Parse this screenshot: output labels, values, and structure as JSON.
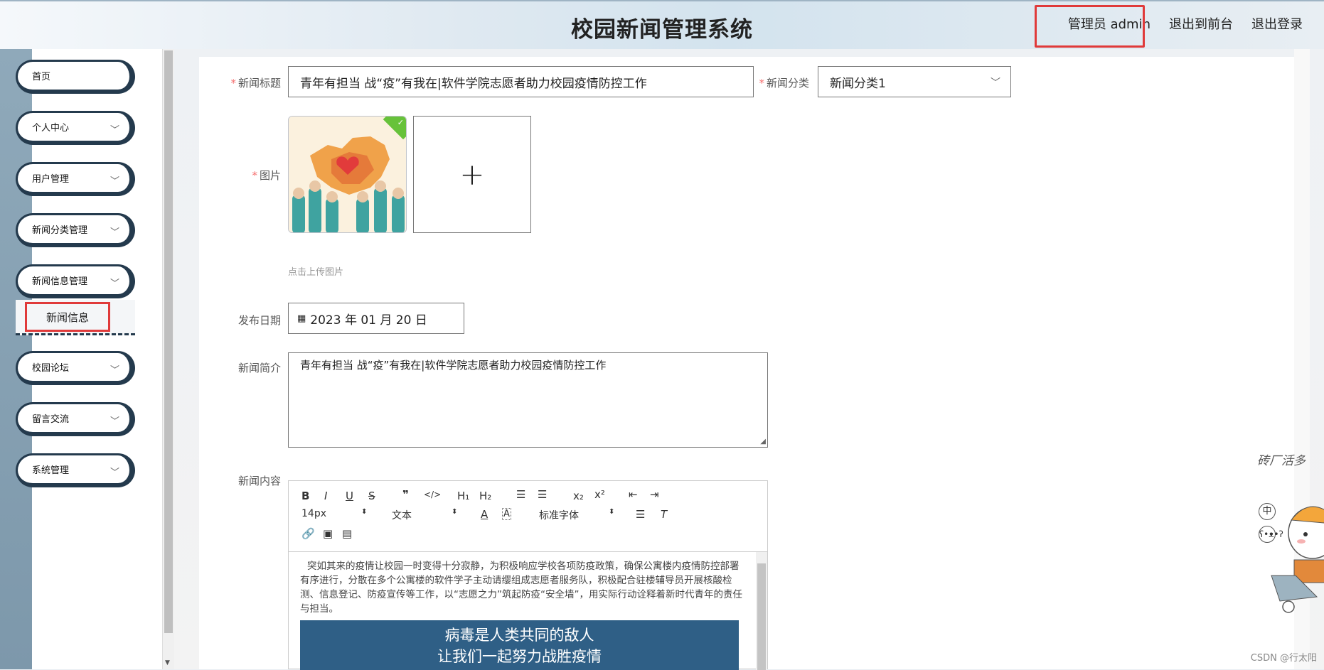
{
  "header": {
    "title": "校园新闻管理系统",
    "admin_label": "管理员 admin",
    "frontend_link": "退出到前台",
    "logout_link": "退出登录"
  },
  "sidebar": {
    "items": [
      {
        "label": "首页"
      },
      {
        "label": "个人中心"
      },
      {
        "label": "用户管理"
      },
      {
        "label": "新闻分类管理"
      },
      {
        "label": "新闻信息管理"
      },
      {
        "label": "校园论坛"
      },
      {
        "label": "留言交流"
      },
      {
        "label": "系统管理"
      }
    ],
    "active_sub": "新闻信息"
  },
  "form": {
    "title_label": "新闻标题",
    "title_value": "青年有担当 战“疫”有我在|软件学院志愿者助力校园疫情防控工作",
    "category_label": "新闻分类",
    "category_value": "新闻分类1",
    "image_label": "图片",
    "upload_plus": "+",
    "upload_hint": "点击上传图片",
    "date_label": "发布日期",
    "date_value": "2023 年 01 月 20 日",
    "summary_label": "新闻简介",
    "summary_value": "青年有担当 战“疫”有我在|软件学院志愿者助力校园疫情防控工作",
    "content_label": "新闻内容"
  },
  "editor": {
    "font_size": "14px",
    "block_type": "文本",
    "font_family": "标准字体",
    "paragraph": "突如其来的疫情让校园一时变得十分寂静，为积极响应学校各项防疫政策，确保公寓楼内疫情防控部署有序进行，分散在多个公寓楼的软件学子主动请缨组成志愿者服务队，积极配合驻楼辅导员开展核酸检测、信息登记、防疫宣传等工作，以“志愿之力”筑起防疫“安全墙”，用实际行动诠释着新时代青年的责任与担当。",
    "banner_line1": "病毒是人类共同的敌人",
    "banner_line2": "让我们一起努力战胜疫情"
  },
  "decoration": {
    "text": "砖厂活多",
    "badge1": "中"
  },
  "watermark": "CSDN @行太阳"
}
